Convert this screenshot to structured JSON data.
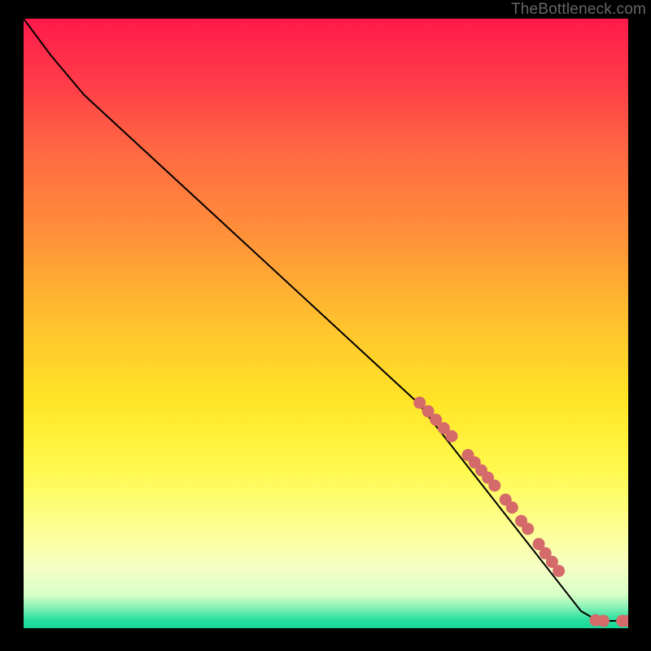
{
  "watermark": "TheBottleneck.com",
  "colors": {
    "bg_black": "#000000",
    "line": "#000000",
    "marker_fill": "#d46a6a",
    "marker_stroke": "#b84f4f"
  },
  "gradient_stops": [
    {
      "offset": 0.0,
      "color": "#ff1a4a"
    },
    {
      "offset": 0.1,
      "color": "#ff3a49"
    },
    {
      "offset": 0.22,
      "color": "#ff6a42"
    },
    {
      "offset": 0.35,
      "color": "#ff8f3a"
    },
    {
      "offset": 0.5,
      "color": "#ffc22e"
    },
    {
      "offset": 0.63,
      "color": "#ffe626"
    },
    {
      "offset": 0.74,
      "color": "#fff94e"
    },
    {
      "offset": 0.83,
      "color": "#fdff8e"
    },
    {
      "offset": 0.9,
      "color": "#f6ffc4"
    },
    {
      "offset": 0.945,
      "color": "#d8ffc8"
    },
    {
      "offset": 0.965,
      "color": "#8cf3b7"
    },
    {
      "offset": 0.985,
      "color": "#2be0a0"
    },
    {
      "offset": 1.0,
      "color": "#19d59a"
    }
  ],
  "chart_data": {
    "type": "line",
    "title": "",
    "xlabel": "",
    "ylabel": "",
    "xlim": [
      0,
      100
    ],
    "ylim": [
      0,
      100
    ],
    "line_points": [
      {
        "x": 0.0,
        "y": 100.0
      },
      {
        "x": 4.5,
        "y": 94.0
      },
      {
        "x": 10.0,
        "y": 87.5
      },
      {
        "x": 65.2,
        "y": 37.0
      },
      {
        "x": 92.2,
        "y": 2.8
      },
      {
        "x": 95.0,
        "y": 1.2
      },
      {
        "x": 100.0,
        "y": 1.2
      }
    ],
    "marker_points": [
      {
        "x": 65.5,
        "y": 37.0
      },
      {
        "x": 66.9,
        "y": 35.6
      },
      {
        "x": 68.2,
        "y": 34.2
      },
      {
        "x": 69.5,
        "y": 32.8
      },
      {
        "x": 70.8,
        "y": 31.5
      },
      {
        "x": 73.5,
        "y": 28.4
      },
      {
        "x": 74.6,
        "y": 27.2
      },
      {
        "x": 75.7,
        "y": 25.9
      },
      {
        "x": 76.8,
        "y": 24.7
      },
      {
        "x": 77.9,
        "y": 23.4
      },
      {
        "x": 79.7,
        "y": 21.1
      },
      {
        "x": 80.8,
        "y": 19.8
      },
      {
        "x": 82.3,
        "y": 17.6
      },
      {
        "x": 83.4,
        "y": 16.3
      },
      {
        "x": 85.2,
        "y": 13.8
      },
      {
        "x": 86.3,
        "y": 12.3
      },
      {
        "x": 87.4,
        "y": 10.9
      },
      {
        "x": 88.5,
        "y": 9.4
      },
      {
        "x": 94.6,
        "y": 1.3
      },
      {
        "x": 95.9,
        "y": 1.2
      },
      {
        "x": 99.0,
        "y": 1.2
      },
      {
        "x": 100.0,
        "y": 1.2
      }
    ]
  }
}
